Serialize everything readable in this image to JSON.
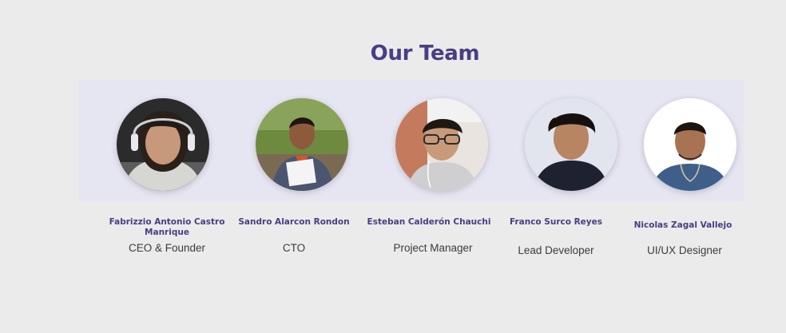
{
  "section": {
    "title": "Our Team"
  },
  "members": [
    {
      "name": "Fabrizzio Antonio Castro Manrique",
      "role": "CEO & Founder",
      "icon": "person-photo-icon"
    },
    {
      "name": "Sandro Alarcon Rondon",
      "role": "CTO",
      "icon": "person-photo-icon"
    },
    {
      "name": "Esteban Calderón Chauchi",
      "role": "Project Manager",
      "icon": "person-photo-icon"
    },
    {
      "name": "Franco Surco Reyes",
      "role": "Lead Developer",
      "icon": "person-photo-icon"
    },
    {
      "name": "Nicolas Zagal Vallejo",
      "role": "UI/UX Designer",
      "icon": "person-photo-icon"
    }
  ],
  "colors": {
    "page_background": "#ebebeb",
    "band_background": "#e6e5f2",
    "accent": "#4a3d84",
    "role_text": "#3c3c3c"
  }
}
